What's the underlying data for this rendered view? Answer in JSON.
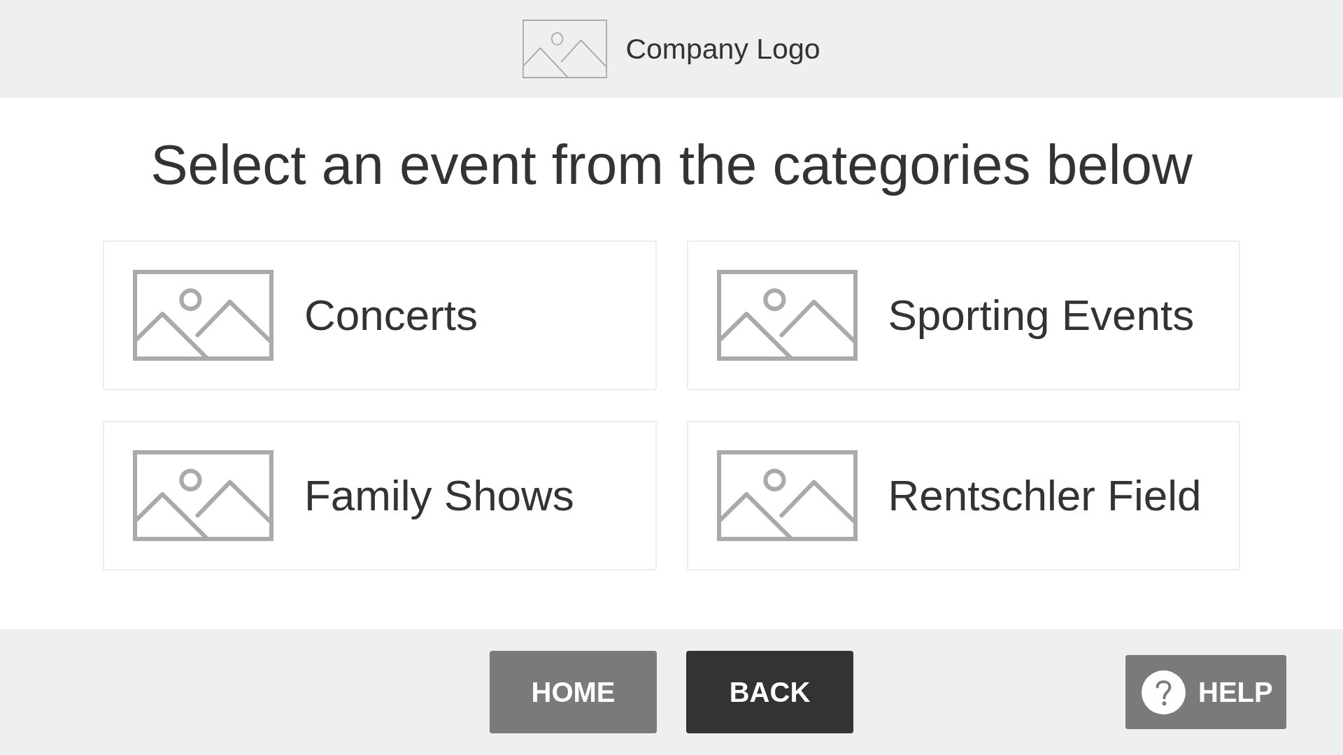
{
  "header": {
    "logo_text": "Company Logo"
  },
  "heading": "Select an event from the categories below",
  "categories": [
    {
      "label": "Concerts"
    },
    {
      "label": "Sporting Events"
    },
    {
      "label": "Family Shows"
    },
    {
      "label": "Rentschler Field"
    }
  ],
  "footer": {
    "nav_buttons": [
      {
        "label": "HOME",
        "kind": "secondary"
      },
      {
        "label": "BACK",
        "kind": "primary"
      }
    ],
    "help_button": {
      "label": "HELP"
    }
  }
}
